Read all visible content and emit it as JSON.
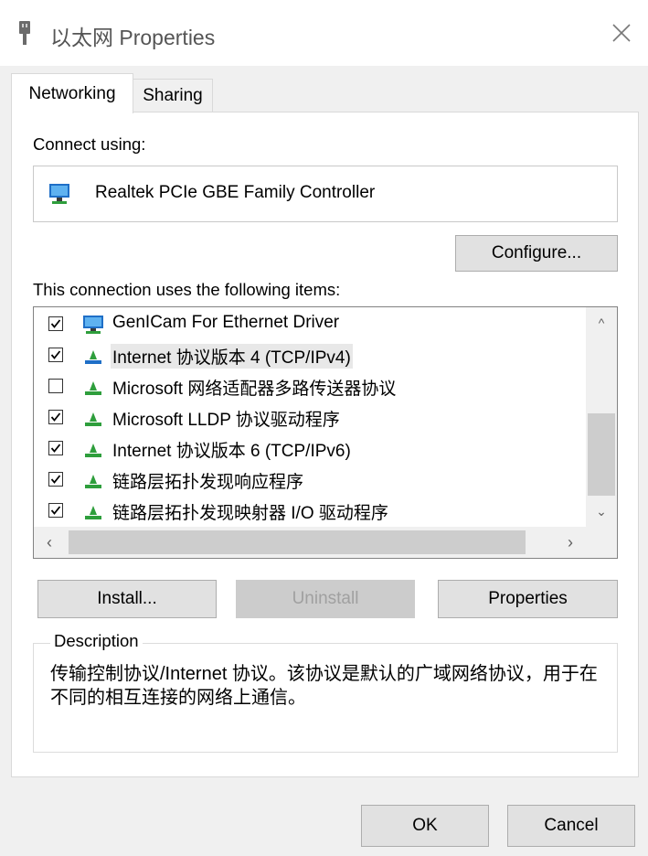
{
  "window": {
    "title": "以太网 Properties"
  },
  "tabs": [
    {
      "label": "Networking",
      "active": true
    },
    {
      "label": "Sharing",
      "active": false
    }
  ],
  "connect_using": {
    "label": "Connect using:",
    "adapter_name": "Realtek PCIe GBE Family Controller",
    "adapter_icon": "network-adapter-icon"
  },
  "configure_button": {
    "label": "Configure..."
  },
  "items_section": {
    "label": "This connection uses the following items:"
  },
  "items": [
    {
      "label": "GenICam For Ethernet Driver",
      "checked": true,
      "icon": "network-client-icon"
    },
    {
      "label": "Internet 协议版本 4 (TCP/IPv4)",
      "checked": true,
      "icon": "network-protocol-icon",
      "selected": true
    },
    {
      "label": "Microsoft 网络适配器多路传送器协议",
      "checked": false,
      "icon": "network-protocol-icon"
    },
    {
      "label": "Microsoft LLDP 协议驱动程序",
      "checked": true,
      "icon": "network-protocol-icon"
    },
    {
      "label": "Internet 协议版本 6 (TCP/IPv6)",
      "checked": true,
      "icon": "network-protocol-icon"
    },
    {
      "label": "链路层拓扑发现响应程序",
      "checked": true,
      "icon": "network-protocol-icon"
    },
    {
      "label": "链路层拓扑发现映射器 I/O 驱动程序",
      "checked": true,
      "icon": "network-protocol-icon"
    }
  ],
  "item_buttons": {
    "install": "Install...",
    "uninstall": "Uninstall",
    "properties": "Properties"
  },
  "description": {
    "legend": "Description",
    "text": "传输控制协议/Internet 协议。该协议是默认的广域网络协议，用于在不同的相互连接的网络上通信。"
  },
  "footer": {
    "ok": "OK",
    "cancel": "Cancel"
  },
  "colors": {
    "window_bg": "#f0f0f0",
    "panel_bg": "#ffffff",
    "button_bg": "#e1e1e1",
    "selected_row": "#e8e8e8",
    "protocol_icon_green": "#2e9e3c"
  }
}
